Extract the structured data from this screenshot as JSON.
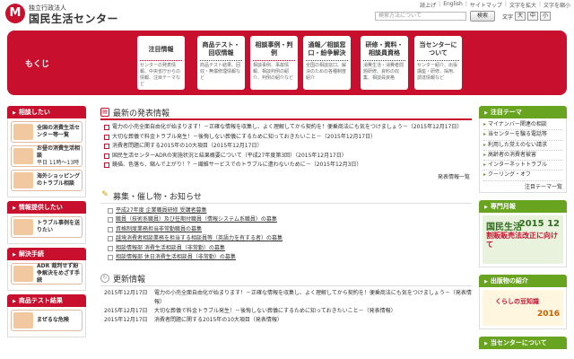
{
  "header": {
    "logo_small": "独立行政法人",
    "logo_name": "国民生活センター",
    "logo_mark": "M",
    "top_links": [
      "読上げ",
      "English",
      "サイトマップ",
      "文字を拡大",
      "文字を縮小"
    ],
    "search_placeholder": "検索方法について",
    "search_button": "検索",
    "font_label": "文字",
    "font_buttons": [
      "大",
      "中",
      "小"
    ]
  },
  "nav": {
    "label": "もくじ",
    "items": [
      {
        "title": "注目情報",
        "desc": "センターの発表情報、中央省庁からの情報、注目テーマなど"
      },
      {
        "title": "商品テスト・回収情報",
        "desc": "商品テスト結果、回収・無償修理情報など"
      },
      {
        "title": "相談事例・判例",
        "desc": "相談事例、事故情報、相談判例の紹介、判例の紹介など"
      },
      {
        "title": "通報／相談窓口・紛争解決",
        "desc": "全国の相談窓口、解決のための各種制度紹介"
      },
      {
        "title": "研修・資料・相談員資格",
        "desc": "消費生活・消費者問題研修、資料の収集、相談員資格"
      },
      {
        "title": "当センターについて",
        "desc": "センター紹介、出張講座・研修、採用、調達情報など"
      }
    ]
  },
  "left": {
    "sections": [
      {
        "title": "相談したい",
        "buttons": [
          {
            "label": "全国の消費生活センター等一覧",
            "sub": ""
          },
          {
            "label": "お昼の消費生活相談",
            "sub": "平日 11時〜13時"
          },
          {
            "label": "海外ショッピングのトラブル相談",
            "sub": ""
          }
        ]
      },
      {
        "title": "情報提供したい",
        "buttons": [
          {
            "label": "トラブル事例を送りたい",
            "sub": ""
          }
        ]
      },
      {
        "title": "解決手続",
        "buttons": [
          {
            "label": "ADR 裁判せず紛争解決をめざす手続",
            "sub": ""
          }
        ]
      },
      {
        "title": "商品テスト結果",
        "buttons": [
          {
            "label": "まぜるな危険",
            "sub": ""
          }
        ]
      }
    ]
  },
  "main": {
    "latest": {
      "title": "最新の発表情報",
      "items": [
        "電力の小売全面自由化が始まります！－正確な情報を収集し、よく理解してから契約を！便乗商法にも気をつけましょう－（2015年12月17日）",
        "大切な葬儀で料金トラブル発生！－後悔しない葬儀にするために知っておきたいこと－（2015年12月17日）",
        "消費者問題に関する2015年の10大項目（2015年12月17日）",
        "国民生活センターADRの実施状況と結果概要について（平成27年度第3回）（2015年12月17日）",
        "鏡描、色落ち、縮んで上がり！？－繊維サービスでのトラブルに遭わないために－（2015年12月3日）"
      ],
      "more": "発表情報一覧"
    },
    "recruit": {
      "title": "募集・催し物・お知らせ",
      "items": [
        "平成27年度 企業職員研修 受講者募集",
        "職員（技術系職員）及び任期付職員（情報システム系職員）の募集",
        "資格制度業務担当非常勤職員の募集",
        "越境消費者相談業務を担当する相談員等（英語力を有する者）の募集",
        "相談情報部 消費生活相談員（非常勤）の募集",
        "相談情報部 休日消費生活相談員（非常勤）の募集"
      ]
    },
    "updates": {
      "title": "更新情報",
      "items": [
        {
          "date": "2015年12月17日",
          "text": "電力の小売全面自由化が始まります！－正確な情報を収集し、よく理解してから契約を！便乗商法にも気をつけましょう－（発表情報）"
        },
        {
          "date": "2015年12月17日",
          "text": "大切な葬儀で料金トラブル発生！－後悔しない葬儀にするために知っておきたいこと－（発表情報）"
        },
        {
          "date": "2015年12月17日",
          "text": "消費者問題に関する2015年の10大項目（発表情報）"
        }
      ]
    }
  },
  "right": {
    "topics": {
      "title": "注目テーマ",
      "items": [
        "マイナンバー関連の相談",
        "当センターを騙る電話等",
        "利用した覚えのない請求",
        "高齢者の消費者被害",
        "インターネットトラブル",
        "クーリング・オフ"
      ],
      "more": "注目テーマ一覧"
    },
    "magazine": {
      "title": "専門月報",
      "cover_title": "国民生活",
      "cover_sub": "割販販売法改正に向けて",
      "issue": "2015 12"
    },
    "publications": {
      "title": "出版物の紹介",
      "book": "くらしの豆知識",
      "year": "2016"
    },
    "about": {
      "title": "当センターについて"
    }
  },
  "colors": {
    "accent": "#c8102e",
    "green": "#69a420"
  }
}
